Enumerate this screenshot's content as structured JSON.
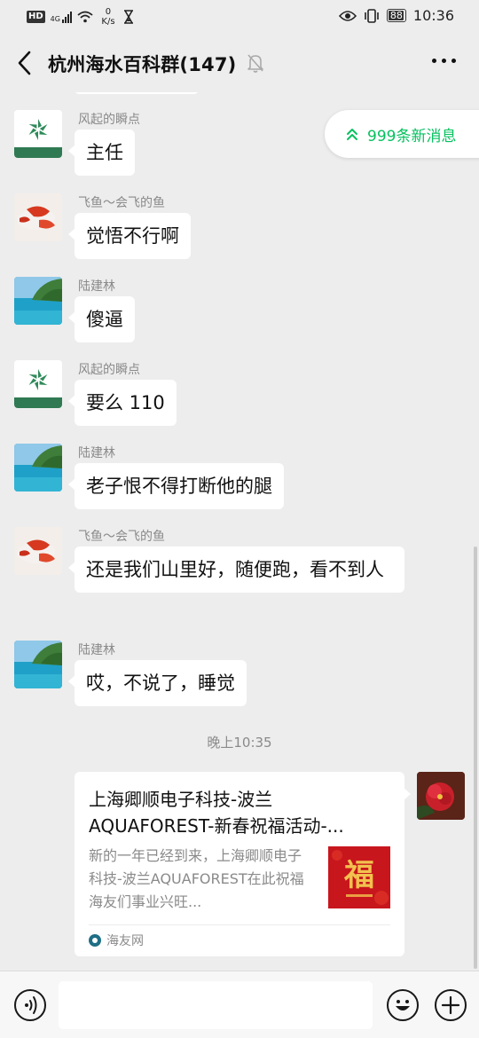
{
  "status_bar": {
    "hd": "HD",
    "network": "4G",
    "speed_value": "0",
    "speed_unit": "K/s",
    "battery": "88",
    "time": "10:36"
  },
  "header": {
    "title": "杭州海水百科群(147)"
  },
  "new_messages": {
    "label": "999条新消息"
  },
  "messages": [
    {
      "sender": "风起的瞬点",
      "text": "主任"
    },
    {
      "sender": "飞鱼～会飞的鱼",
      "text": "觉悟不行啊"
    },
    {
      "sender": "陆建林",
      "text": "傻逼"
    },
    {
      "sender": "风起的瞬点",
      "text": "要么 110"
    },
    {
      "sender": "陆建林",
      "text": "老子恨不得打断他的腿"
    },
    {
      "sender": "飞鱼～会飞的鱼",
      "text": "还是我们山里好，随便跑，看不到人"
    },
    {
      "sender": "陆建林",
      "text": "哎，不说了，睡觉"
    }
  ],
  "timestamp": "晚上10:35",
  "link_card": {
    "title": "上海卿顺电子科技-波兰AQUAFOREST-新春祝福活动-...",
    "description": "新的一年已经到来，上海卿顺电子科技-波兰AQUAFOREST在此祝福海友们事业兴旺...",
    "thumb_text": "福",
    "source": "海友网"
  },
  "colors": {
    "accent_green": "#07c160",
    "background": "#ededed",
    "bubble": "#ffffff"
  }
}
